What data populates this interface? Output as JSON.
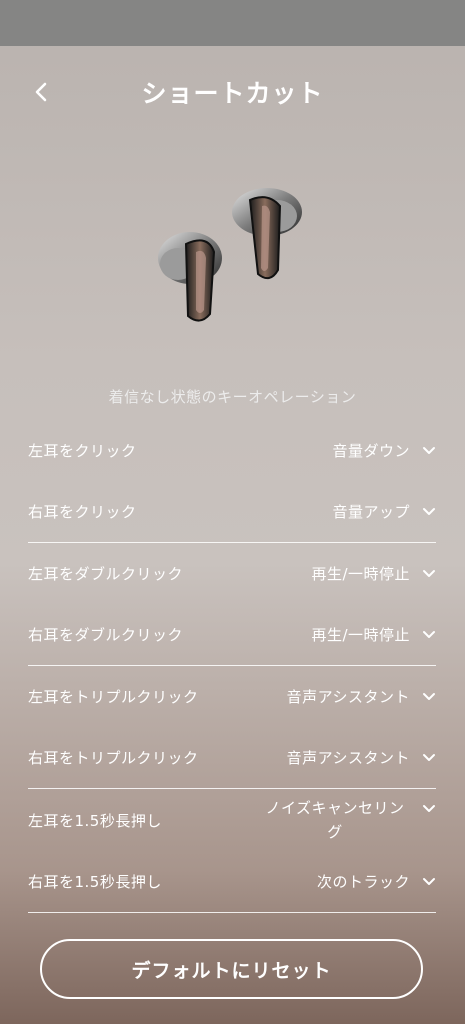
{
  "header": {
    "title": "ショートカット"
  },
  "section": {
    "title": "着信なし状態のキーオペレーション"
  },
  "rows": [
    {
      "label": "左耳をクリック",
      "value": "音量ダウン"
    },
    {
      "label": "右耳をクリック",
      "value": "音量アップ"
    },
    {
      "label": "左耳をダブルクリック",
      "value": "再生/一時停止"
    },
    {
      "label": "右耳をダブルクリック",
      "value": "再生/一時停止"
    },
    {
      "label": "左耳をトリプルクリック",
      "value": "音声アシスタント"
    },
    {
      "label": "右耳をトリプルクリック",
      "value": "音声アシスタント"
    },
    {
      "label": "左耳を1.5秒長押し",
      "value": "ノイズキャンセリング"
    },
    {
      "label": "右耳を1.5秒長押し",
      "value": "次のトラック"
    }
  ],
  "footer": {
    "reset_label": "デフォルトにリセット"
  },
  "icons": {
    "back": "chevron-left-icon",
    "dropdown": "chevron-down-icon"
  },
  "colors": {
    "divider": "#ffffff",
    "status_bar": "#858584"
  }
}
